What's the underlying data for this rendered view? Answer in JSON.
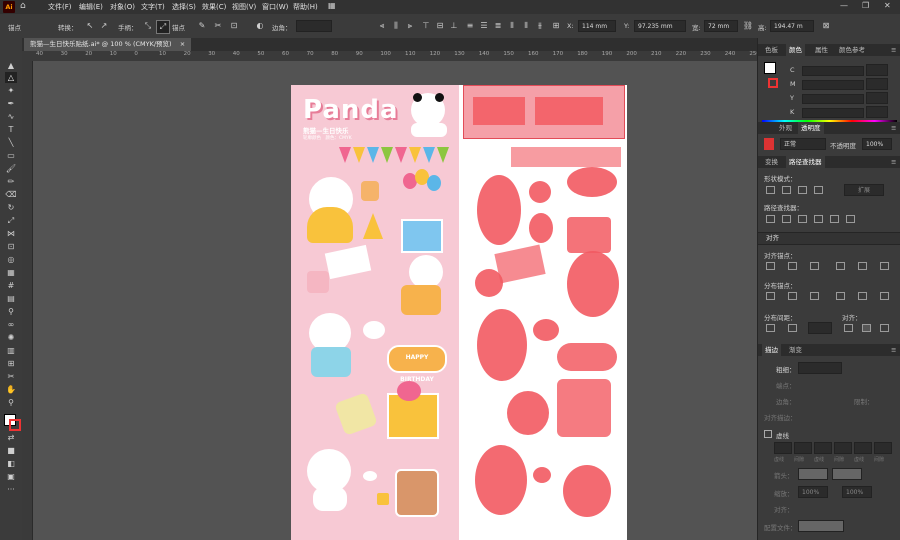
{
  "app": {
    "logo": "Ai"
  },
  "menubar": {
    "items": [
      "文件(F)",
      "编辑(E)",
      "对象(O)",
      "文字(T)",
      "选择(S)",
      "效果(C)",
      "视图(V)",
      "窗口(W)",
      "帮助(H)"
    ],
    "icons": [
      "home-icon",
      "layout-icon"
    ]
  },
  "control_bar": {
    "anchor_label": "锚点",
    "convert_label": "转换：",
    "handle_label": "手柄：",
    "anchor2_label": "锚点",
    "corner_label": "边角：",
    "x_label": "X:",
    "x_value": "114 mm",
    "y_label": "Y:",
    "y_value": "97.235 mm",
    "w_label": "宽:",
    "w_value": "72 mm",
    "h_label": "高:",
    "h_value": "194.47 m"
  },
  "document": {
    "tab_title": "熊猫—生日快乐贴纸.ai* @ 100 % (CMYK/预览)",
    "close": "×"
  },
  "ruler": {
    "ticks": [
      "40",
      "30",
      "20",
      "10",
      "0",
      "10",
      "20",
      "30",
      "40",
      "50",
      "60",
      "70",
      "80",
      "90",
      "100",
      "110",
      "120",
      "130",
      "140",
      "150",
      "160",
      "170",
      "180",
      "190",
      "200",
      "210",
      "220",
      "230",
      "240",
      "250"
    ]
  },
  "artwork": {
    "title": "Panda",
    "subtitle": "熊猫—生日快乐",
    "meta": "轮廓颜色　颜色：CMYK",
    "banner_text": "HAPPY BIRTHDAY"
  },
  "color_panel": {
    "tabs": [
      "色板",
      "颜色",
      "属性",
      "颜色参考"
    ],
    "active_tab": 1,
    "channels": [
      "C",
      "M",
      "Y",
      "K"
    ]
  },
  "appearance_panel": {
    "tabs": [
      "外观",
      "透明度"
    ],
    "active_tab": 1,
    "mode": "正常",
    "opacity_label": "不透明度",
    "opacity_value": "100%"
  },
  "pathfinder_panel": {
    "tabs": [
      "变换",
      "路径查找器"
    ],
    "active_tab": 1,
    "shape_modes_label": "形状模式：",
    "expand_button": "扩展",
    "pathfinders_label": "路径查找器："
  },
  "align_panel": {
    "tab": "对齐",
    "align_objects": "对齐锚点：",
    "distribute_objects": "分布锚点：",
    "distribute_spacing": "分布间距：",
    "align_to": "对齐："
  },
  "stroke_panel": {
    "tabs": [
      "描边",
      "渐变"
    ],
    "active_tab": 0,
    "weight_label": "粗细：",
    "cap_label": "端点：",
    "corner_label": "边角：",
    "align_label": "对齐描边：",
    "limit_label": "限制：",
    "dashed_label": "虚线",
    "dash_labels": [
      "虚线",
      "间隙",
      "虚线",
      "间隙",
      "虚线",
      "间隙"
    ],
    "arrowhead_label": "箭头：",
    "scale_label": "缩放：",
    "scale_values": [
      "100%",
      "100%"
    ],
    "align_arrow_label": "对齐：",
    "profile_label": "配置文件："
  }
}
